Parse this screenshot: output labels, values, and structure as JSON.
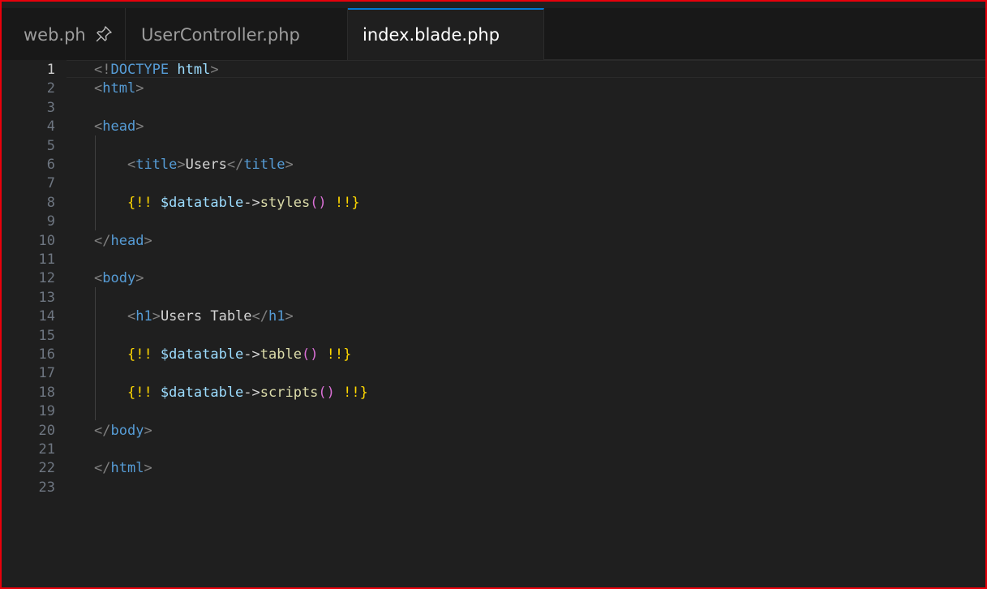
{
  "tabs": [
    {
      "label": "web.php",
      "pinned": true,
      "active": false
    },
    {
      "label": "UserController.php",
      "pinned": false,
      "active": false
    },
    {
      "label": "index.blade.php",
      "pinned": false,
      "active": true
    }
  ],
  "colors": {
    "accent": "#0078d4",
    "frame_border": "#e8000b",
    "editor_bg": "#1f1f1f",
    "tab_bg": "#181818"
  },
  "editor": {
    "active_line": 1,
    "lines": [
      {
        "n": "1",
        "tokens": [
          {
            "t": "<!",
            "c": "punc"
          },
          {
            "t": "DOCTYPE",
            "c": "tag"
          },
          {
            "t": " ",
            "c": "text"
          },
          {
            "t": "html",
            "c": "attr"
          },
          {
            "t": ">",
            "c": "punc"
          }
        ]
      },
      {
        "n": "2",
        "tokens": [
          {
            "t": "<",
            "c": "punc"
          },
          {
            "t": "html",
            "c": "tag"
          },
          {
            "t": ">",
            "c": "punc"
          }
        ]
      },
      {
        "n": "3",
        "tokens": []
      },
      {
        "n": "4",
        "tokens": [
          {
            "t": "<",
            "c": "punc"
          },
          {
            "t": "head",
            "c": "tag"
          },
          {
            "t": ">",
            "c": "punc"
          }
        ]
      },
      {
        "n": "5",
        "tokens": []
      },
      {
        "n": "6",
        "tokens": [
          {
            "t": "    ",
            "c": "text"
          },
          {
            "t": "<",
            "c": "punc"
          },
          {
            "t": "title",
            "c": "tag"
          },
          {
            "t": ">",
            "c": "punc"
          },
          {
            "t": "Users",
            "c": "text"
          },
          {
            "t": "</",
            "c": "punc"
          },
          {
            "t": "title",
            "c": "tag"
          },
          {
            "t": ">",
            "c": "punc"
          }
        ]
      },
      {
        "n": "7",
        "tokens": []
      },
      {
        "n": "8",
        "tokens": [
          {
            "t": "    ",
            "c": "text"
          },
          {
            "t": "{",
            "c": "brace"
          },
          {
            "t": "!! ",
            "c": "bang"
          },
          {
            "t": "$datatable",
            "c": "var"
          },
          {
            "t": "->",
            "c": "op"
          },
          {
            "t": "styles",
            "c": "fn"
          },
          {
            "t": "()",
            "c": "paren"
          },
          {
            "t": " !!",
            "c": "bang"
          },
          {
            "t": "}",
            "c": "brace"
          }
        ]
      },
      {
        "n": "9",
        "tokens": []
      },
      {
        "n": "10",
        "tokens": [
          {
            "t": "</",
            "c": "punc"
          },
          {
            "t": "head",
            "c": "tag"
          },
          {
            "t": ">",
            "c": "punc"
          }
        ]
      },
      {
        "n": "11",
        "tokens": []
      },
      {
        "n": "12",
        "tokens": [
          {
            "t": "<",
            "c": "punc"
          },
          {
            "t": "body",
            "c": "tag"
          },
          {
            "t": ">",
            "c": "punc"
          }
        ]
      },
      {
        "n": "13",
        "tokens": []
      },
      {
        "n": "14",
        "tokens": [
          {
            "t": "    ",
            "c": "text"
          },
          {
            "t": "<",
            "c": "punc"
          },
          {
            "t": "h1",
            "c": "tag"
          },
          {
            "t": ">",
            "c": "punc"
          },
          {
            "t": "Users Table",
            "c": "text"
          },
          {
            "t": "</",
            "c": "punc"
          },
          {
            "t": "h1",
            "c": "tag"
          },
          {
            "t": ">",
            "c": "punc"
          }
        ]
      },
      {
        "n": "15",
        "tokens": []
      },
      {
        "n": "16",
        "tokens": [
          {
            "t": "    ",
            "c": "text"
          },
          {
            "t": "{",
            "c": "brace"
          },
          {
            "t": "!! ",
            "c": "bang"
          },
          {
            "t": "$datatable",
            "c": "var"
          },
          {
            "t": "->",
            "c": "op"
          },
          {
            "t": "table",
            "c": "fn"
          },
          {
            "t": "()",
            "c": "paren"
          },
          {
            "t": " !!",
            "c": "bang"
          },
          {
            "t": "}",
            "c": "brace"
          }
        ]
      },
      {
        "n": "17",
        "tokens": []
      },
      {
        "n": "18",
        "tokens": [
          {
            "t": "    ",
            "c": "text"
          },
          {
            "t": "{",
            "c": "brace"
          },
          {
            "t": "!! ",
            "c": "bang"
          },
          {
            "t": "$datatable",
            "c": "var"
          },
          {
            "t": "->",
            "c": "op"
          },
          {
            "t": "scripts",
            "c": "fn"
          },
          {
            "t": "()",
            "c": "paren"
          },
          {
            "t": " !!",
            "c": "bang"
          },
          {
            "t": "}",
            "c": "brace"
          }
        ]
      },
      {
        "n": "19",
        "tokens": []
      },
      {
        "n": "20",
        "tokens": [
          {
            "t": "</",
            "c": "punc"
          },
          {
            "t": "body",
            "c": "tag"
          },
          {
            "t": ">",
            "c": "punc"
          }
        ]
      },
      {
        "n": "21",
        "tokens": []
      },
      {
        "n": "22",
        "tokens": [
          {
            "t": "</",
            "c": "punc"
          },
          {
            "t": "html",
            "c": "tag"
          },
          {
            "t": ">",
            "c": "punc"
          }
        ]
      },
      {
        "n": "23",
        "tokens": []
      }
    ]
  }
}
